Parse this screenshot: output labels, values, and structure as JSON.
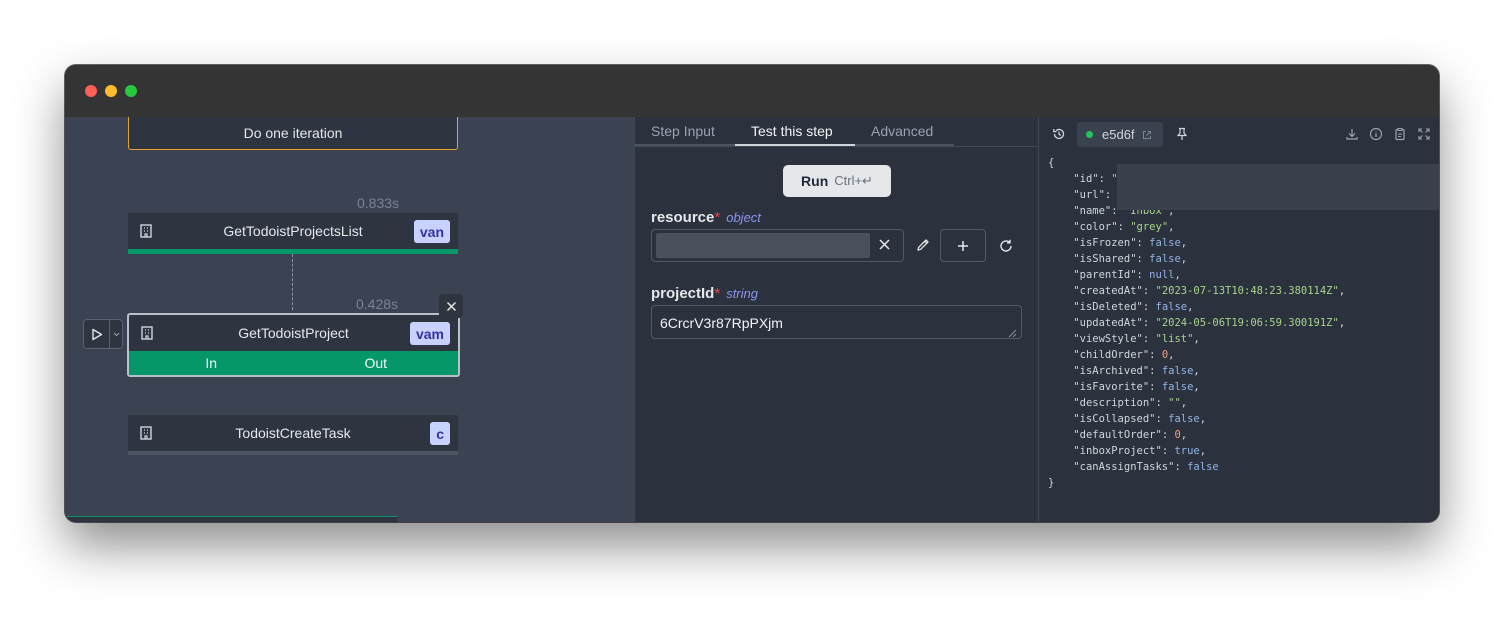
{
  "flow": {
    "iteration_label": "Do one iteration",
    "nodes": [
      {
        "name": "GetTodoistProjectsList",
        "badge": "van",
        "timing": "0.833s"
      },
      {
        "name": "GetTodoistProject",
        "badge": "vam",
        "timing": "0.428s",
        "in_label": "In",
        "out_label": "Out"
      },
      {
        "name": "TodoistCreateTask",
        "badge": "c"
      }
    ]
  },
  "tabs": [
    {
      "label": "Step Input",
      "active": false
    },
    {
      "label": "Test this step",
      "active": true
    },
    {
      "label": "Advanced",
      "active": false
    }
  ],
  "run_button": {
    "label": "Run",
    "shortcut": "Ctrl+↵"
  },
  "fields": {
    "resource": {
      "label": "resource",
      "required_mark": "*",
      "type": "object"
    },
    "projectId": {
      "label": "projectId",
      "required_mark": "*",
      "type": "string",
      "value": "6CrcrV3r87RpPXjm"
    }
  },
  "result": {
    "job_id": "e5d6f",
    "status_color": "#22c55e",
    "json_lines": [
      {
        "indent": 0,
        "text": "{"
      },
      {
        "indent": 1,
        "key": "\"id\"",
        "value": "\"",
        "kind": "s",
        "comma": ""
      },
      {
        "indent": 1,
        "key": "\"url\"",
        "value": "",
        "kind": "s",
        "comma": ""
      },
      {
        "indent": 1,
        "key": "\"name\"",
        "value": "\"Inbox\"",
        "kind": "s",
        "comma": ","
      },
      {
        "indent": 1,
        "key": "\"color\"",
        "value": "\"grey\"",
        "kind": "s",
        "comma": ","
      },
      {
        "indent": 1,
        "key": "\"isFrozen\"",
        "value": "false",
        "kind": "b",
        "comma": ","
      },
      {
        "indent": 1,
        "key": "\"isShared\"",
        "value": "false",
        "kind": "b",
        "comma": ","
      },
      {
        "indent": 1,
        "key": "\"parentId\"",
        "value": "null",
        "kind": "b",
        "comma": ","
      },
      {
        "indent": 1,
        "key": "\"createdAt\"",
        "value": "\"2023-07-13T10:48:23.380114Z\"",
        "kind": "s",
        "comma": ","
      },
      {
        "indent": 1,
        "key": "\"isDeleted\"",
        "value": "false",
        "kind": "b",
        "comma": ","
      },
      {
        "indent": 1,
        "key": "\"updatedAt\"",
        "value": "\"2024-05-06T19:06:59.300191Z\"",
        "kind": "s",
        "comma": ","
      },
      {
        "indent": 1,
        "key": "\"viewStyle\"",
        "value": "\"list\"",
        "kind": "s",
        "comma": ","
      },
      {
        "indent": 1,
        "key": "\"childOrder\"",
        "value": "0",
        "kind": "n",
        "comma": ","
      },
      {
        "indent": 1,
        "key": "\"isArchived\"",
        "value": "false",
        "kind": "b",
        "comma": ","
      },
      {
        "indent": 1,
        "key": "\"isFavorite\"",
        "value": "false",
        "kind": "b",
        "comma": ","
      },
      {
        "indent": 1,
        "key": "\"description\"",
        "value": "\"\"",
        "kind": "s",
        "comma": ","
      },
      {
        "indent": 1,
        "key": "\"isCollapsed\"",
        "value": "false",
        "kind": "b",
        "comma": ","
      },
      {
        "indent": 1,
        "key": "\"defaultOrder\"",
        "value": "0",
        "kind": "n",
        "comma": ","
      },
      {
        "indent": 1,
        "key": "\"inboxProject\"",
        "value": "true",
        "kind": "b",
        "comma": ","
      },
      {
        "indent": 1,
        "key": "\"canAssignTasks\"",
        "value": "false",
        "kind": "b",
        "comma": ""
      },
      {
        "indent": 0,
        "text": "}"
      }
    ]
  }
}
